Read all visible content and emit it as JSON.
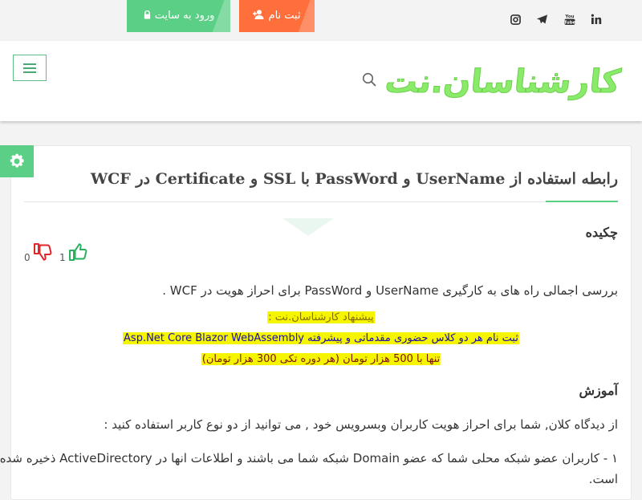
{
  "topbar": {
    "login_label": "ورود به سایت",
    "register_label": "ثبت نام",
    "social": [
      "instagram-icon",
      "telegram-icon",
      "youtube-icon",
      "linkedin-icon"
    ],
    "youtube_label": "You Tube",
    "linkedin_label": "in"
  },
  "header": {
    "logo_text": "کارشناسان.نت",
    "menu_icon": "hamburger-icon",
    "search_icon": "search-icon"
  },
  "article": {
    "title": "رابطه استفاده از UserName و PassWord با SSL و Certificate در WCF",
    "abstract_heading": "چکیده",
    "likes": "1",
    "dislikes": "0",
    "abstract_text": "بررسی اجمالی راه های به کارگیری UserName و PassWord برای احراز هویت در WCF .",
    "promo": [
      "پیشنهاد کارشناسان.نت :",
      "ثبت نام هر دو کلاس حضوری مقدماتی و پیشرفته Asp.Net Core Blazor WebAssembly",
      "تنها با 500 هزار تومان (هر دوره تکی 300 هزار تومان)"
    ],
    "tutorial_heading": "آموزش",
    "tutorial_intro": "از دیدگاه کلان, شما برای احراز هویت کاربران وبسرویس خود , می توانید از دو نوع کاربر استفاده کنید :",
    "item1_line1": "۱ - کاربران عضو شبکه محلی شما که عضو Domain شبکه شما می باشند و اطلاعات انها در ActiveDirectory ذخیره شده",
    "item1_line2": "است."
  },
  "colors": {
    "accent_green": "#5ccf86",
    "register_orange": "#ff6f3c",
    "like_green": "#2ab15f",
    "dislike_red": "#e0252b",
    "logo_green": "#8aea6a",
    "promo_highlight": "#f5f500",
    "promo_title_color": "#8a6d00",
    "promo_course_color": "#1a0dab",
    "promo_price_color": "#7a1a00"
  }
}
